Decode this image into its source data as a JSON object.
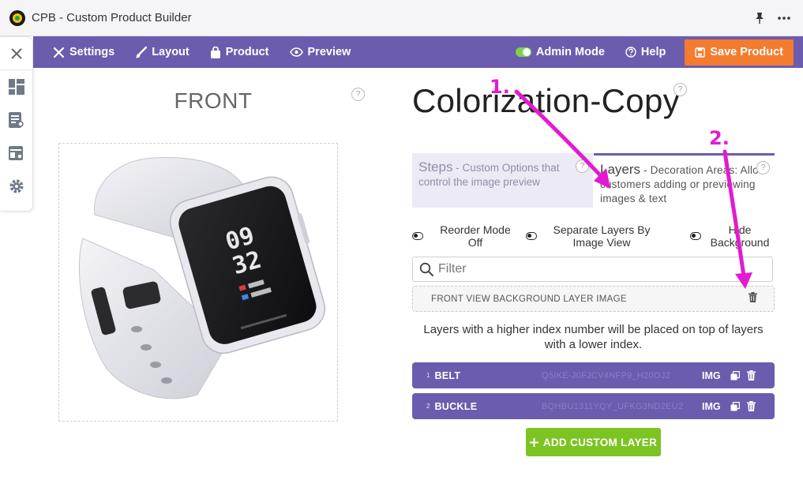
{
  "window": {
    "title": "CPB - Custom Product Builder"
  },
  "nav": {
    "items": [
      {
        "label": "Settings",
        "icon": "tools-icon"
      },
      {
        "label": "Layout",
        "icon": "brush-icon"
      },
      {
        "label": "Product",
        "icon": "bag-icon"
      },
      {
        "label": "Preview",
        "icon": "eye-icon"
      }
    ],
    "admin_mode": "Admin Mode",
    "help": "Help",
    "save": "Save Product"
  },
  "colors": {
    "nav_bg": "#6c5cae",
    "save_btn": "#f47c2e",
    "add_btn": "#7cc423",
    "annotation": "#e31bcf"
  },
  "preview": {
    "view_title": "FRONT",
    "help_mark": "?"
  },
  "product": {
    "title": "Colorization-Copy"
  },
  "tabs": {
    "steps": {
      "head": "Steps",
      "desc": " - Custom Options that control the image preview"
    },
    "layers": {
      "head": "Layers",
      "desc": " - Decoration Areas: Allow customers adding or previewing images & text"
    }
  },
  "toggles": {
    "reorder": "Reorder Mode Off",
    "separate": "Separate Layers By Image View",
    "hide_bg": "Hide Background"
  },
  "filter": {
    "placeholder": "Filter"
  },
  "background_layer": {
    "label": "FRONT VIEW BACKGROUND LAYER IMAGE"
  },
  "layer_note": "Layers with a higher index number will be placed on top of layers with a lower index.",
  "layers": [
    {
      "index": "1",
      "name": "BELT",
      "code": "Q5IKE-J0FJCV4NFP9_H20OJ2",
      "type": "IMG"
    },
    {
      "index": "2",
      "name": "BUCKLE",
      "code": "BQHBU1311YQY_UFKG3ND2EU2",
      "type": "IMG"
    }
  ],
  "add_layer": "ADD CUSTOM LAYER",
  "annotations": [
    {
      "label": "1."
    },
    {
      "label": "2."
    }
  ]
}
